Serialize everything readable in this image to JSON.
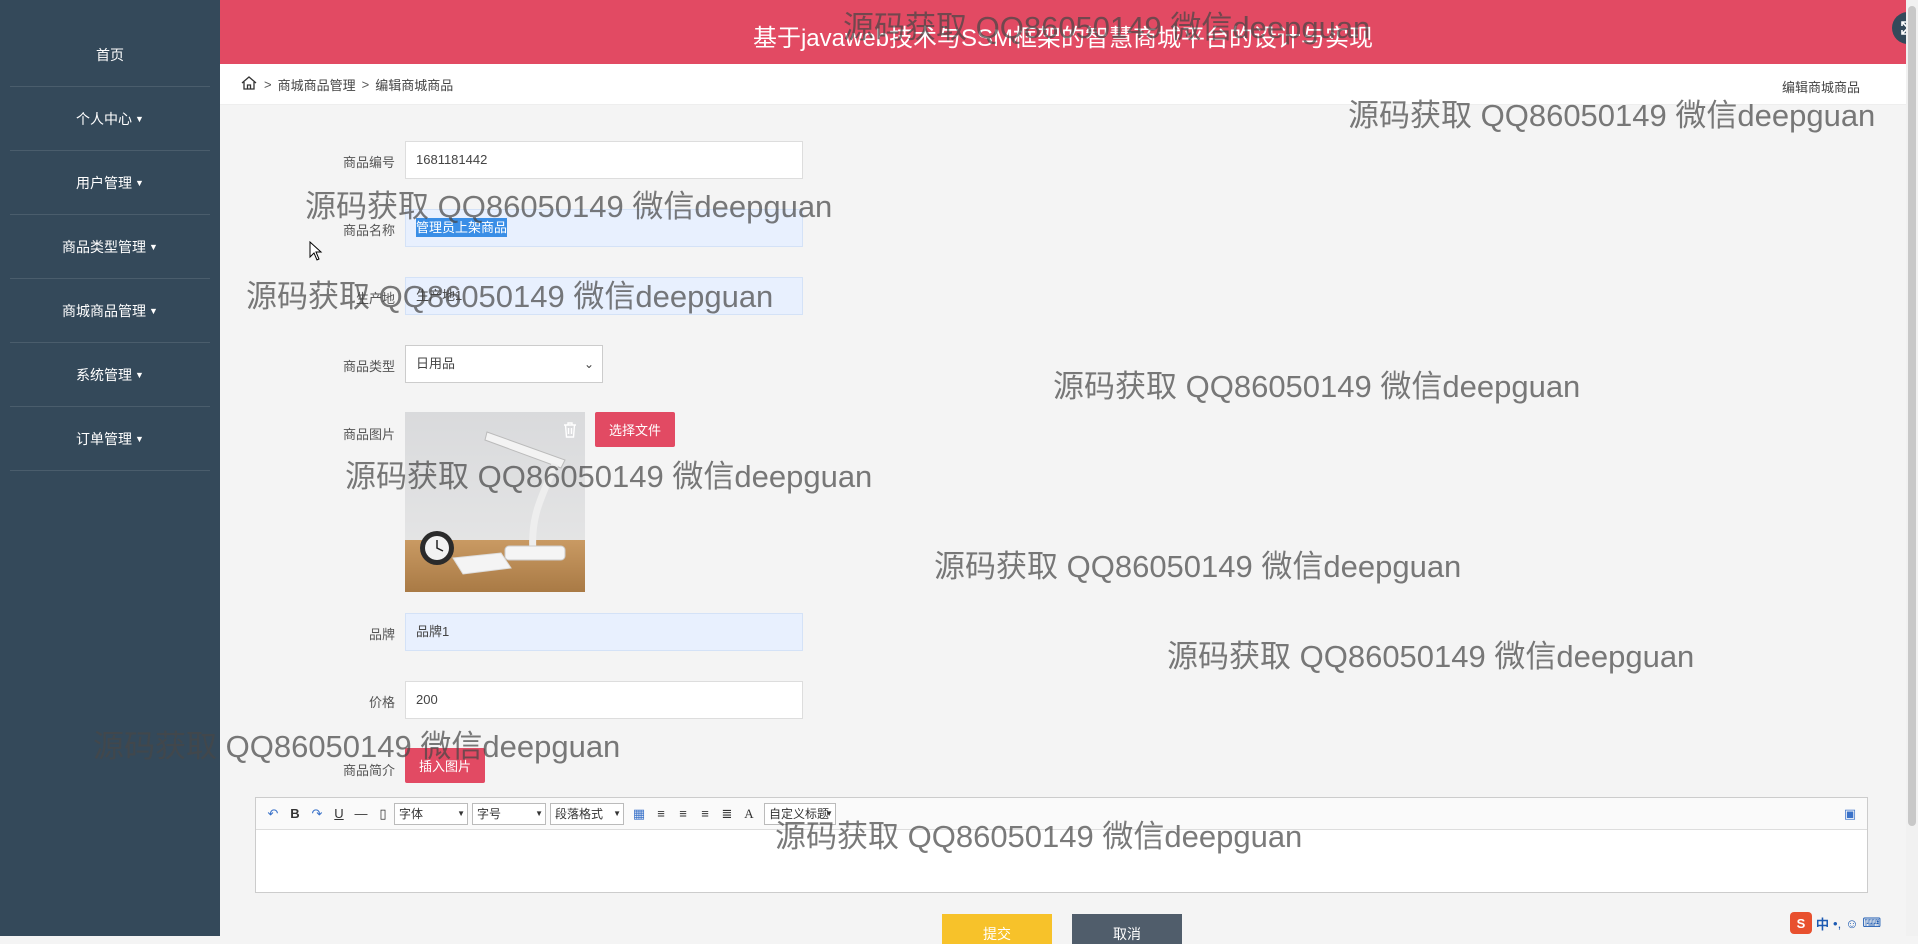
{
  "app": {
    "title": "基于javaweb技术与SSM框架的智慧商城平台的设计与实现"
  },
  "sidebar": {
    "items": [
      {
        "label": "首页",
        "caret": false
      },
      {
        "label": "个人中心",
        "caret": true
      },
      {
        "label": "用户管理",
        "caret": true
      },
      {
        "label": "商品类型管理",
        "caret": true
      },
      {
        "label": "商城商品管理",
        "caret": true
      },
      {
        "label": "系统管理",
        "caret": true
      },
      {
        "label": "订单管理",
        "caret": true
      }
    ]
  },
  "breadcrumb": {
    "items": [
      "商城商品管理",
      "编辑商城商品"
    ],
    "sep": ">",
    "current": "编辑商城商品"
  },
  "form": {
    "code_label": "商品编号",
    "code_value": "1681181442",
    "name_label": "商品名称",
    "name_value": "管理员上架商品",
    "origin_label": "生产地",
    "origin_value": "生产地1",
    "type_label": "商品类型",
    "type_value": "日用品",
    "image_label": "商品图片",
    "file_button": "选择文件",
    "brand_label": "品牌",
    "brand_value": "品牌1",
    "price_label": "价格",
    "price_value": "200",
    "intro_label": "商品简介",
    "insert_image_button": "插入图片"
  },
  "editor": {
    "font_family": "字体",
    "font_size": "字号",
    "paragraph": "段落格式",
    "custom_title": "自定义标题"
  },
  "actions": {
    "submit": "提交",
    "cancel": "取消"
  },
  "ime": {
    "lang": "中"
  },
  "watermark": {
    "text": "源码获取 QQ86050149 微信deepguan"
  },
  "colors": {
    "sidebar": "#34495a",
    "header": "#e24a63",
    "accent": "#e24a63",
    "submit": "#f7c22a",
    "cancel": "#505d6b",
    "avatar": "#f5c224"
  }
}
